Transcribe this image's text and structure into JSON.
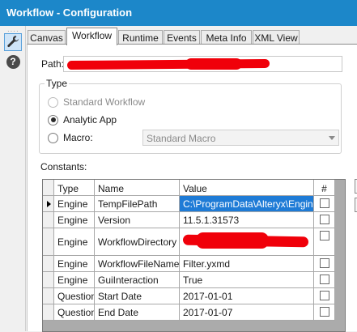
{
  "window": {
    "title": "Workflow - Configuration"
  },
  "toolbar": {
    "grip": "····",
    "tool_icon": "wrench-icon",
    "help_glyph": "?"
  },
  "tabs": [
    {
      "label": "Canvas"
    },
    {
      "label": "Workflow"
    },
    {
      "label": "Runtime"
    },
    {
      "label": "Events"
    },
    {
      "label": "Meta Info"
    },
    {
      "label": "XML View"
    }
  ],
  "path": {
    "label": "Path:",
    "value_redacted": true
  },
  "type_group": {
    "label": "Type",
    "options": [
      {
        "label": "Standard Workflow",
        "selected": false,
        "enabled": false
      },
      {
        "label": "Analytic App",
        "selected": true,
        "enabled": true
      },
      {
        "label": "Macro:",
        "selected": false,
        "enabled": true
      }
    ],
    "macro_select": {
      "value": "Standard Macro"
    }
  },
  "constants": {
    "label": "Constants:",
    "columns": [
      "Type",
      "Name",
      "Value",
      "#"
    ],
    "rows": [
      {
        "type": "Engine",
        "name": "TempFilePath",
        "value": "C:\\ProgramData\\Alteryx\\Engine",
        "checked": false,
        "selected": true
      },
      {
        "type": "Engine",
        "name": "Version",
        "value": "11.5.1.31573",
        "checked": false
      },
      {
        "type": "Engine",
        "name": "WorkflowDirectory",
        "value": "",
        "value_redacted": true,
        "checked": false
      },
      {
        "type": "Engine",
        "name": "WorkflowFileName",
        "value": "Filter.yxmd",
        "checked": false
      },
      {
        "type": "Engine",
        "name": "GuiInteraction",
        "value": "True",
        "checked": false
      },
      {
        "type": "Question",
        "name": "Start Date",
        "value": "2017-01-01",
        "checked": false
      },
      {
        "type": "Question",
        "name": "End Date",
        "value": "2017-01-07",
        "checked": false
      }
    ]
  },
  "colors": {
    "titlebar": "#1c87c9",
    "selection": "#1e7bd6",
    "redaction": "#f0000a"
  }
}
